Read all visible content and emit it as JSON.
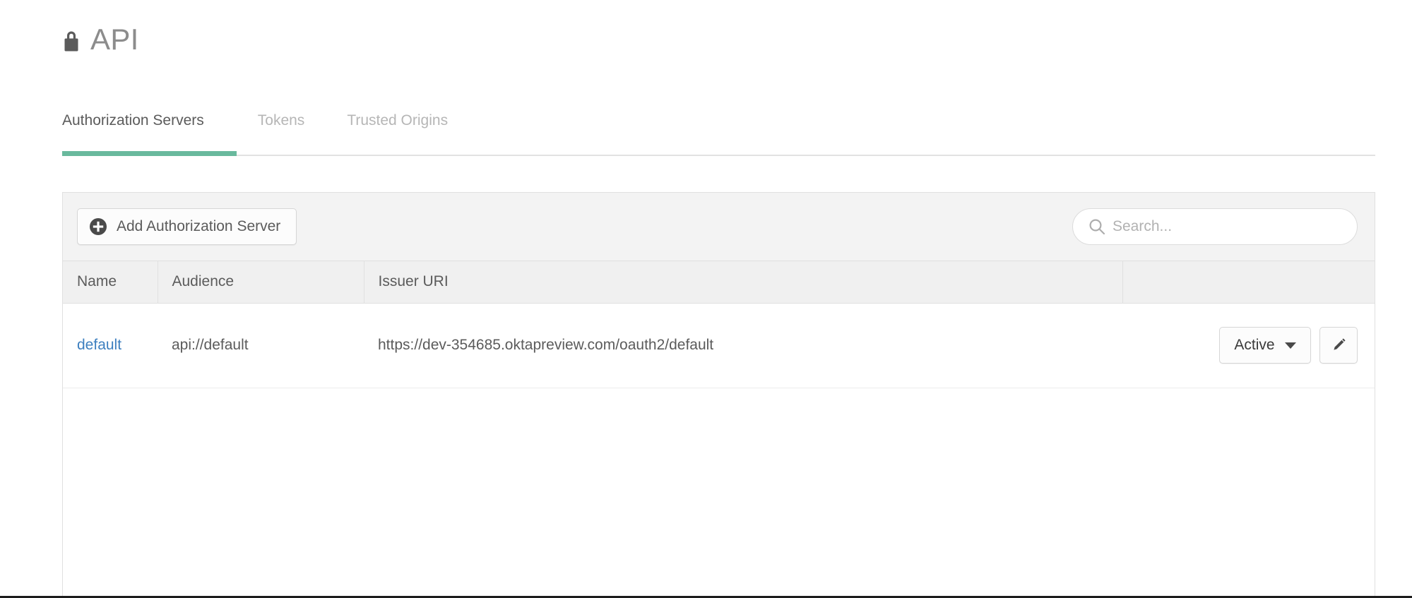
{
  "header": {
    "title": "API",
    "icon": "lock-icon"
  },
  "tabs": [
    {
      "label": "Authorization Servers",
      "active": true
    },
    {
      "label": "Tokens",
      "active": false
    },
    {
      "label": "Trusted Origins",
      "active": false
    }
  ],
  "toolbar": {
    "add_button_label": "Add Authorization Server",
    "add_button_icon": "plus-circle-icon",
    "search": {
      "placeholder": "Search...",
      "value": "",
      "icon": "search-icon"
    }
  },
  "table": {
    "columns": [
      "Name",
      "Audience",
      "Issuer URI",
      ""
    ],
    "rows": [
      {
        "name": "default",
        "audience": "api://default",
        "issuer_uri": "https://dev-354685.oktapreview.com/oauth2/default",
        "status": "Active",
        "edit_icon": "pencil-icon"
      }
    ]
  },
  "colors": {
    "accent_green": "#69b99d",
    "link_blue": "#3d7fbf",
    "text_primary": "#5b5b5b",
    "text_muted": "#b6b6b6",
    "panel_border": "#e0e0e0",
    "toolbar_bg": "#f3f3f3",
    "header_bg": "#f0f0f0"
  }
}
